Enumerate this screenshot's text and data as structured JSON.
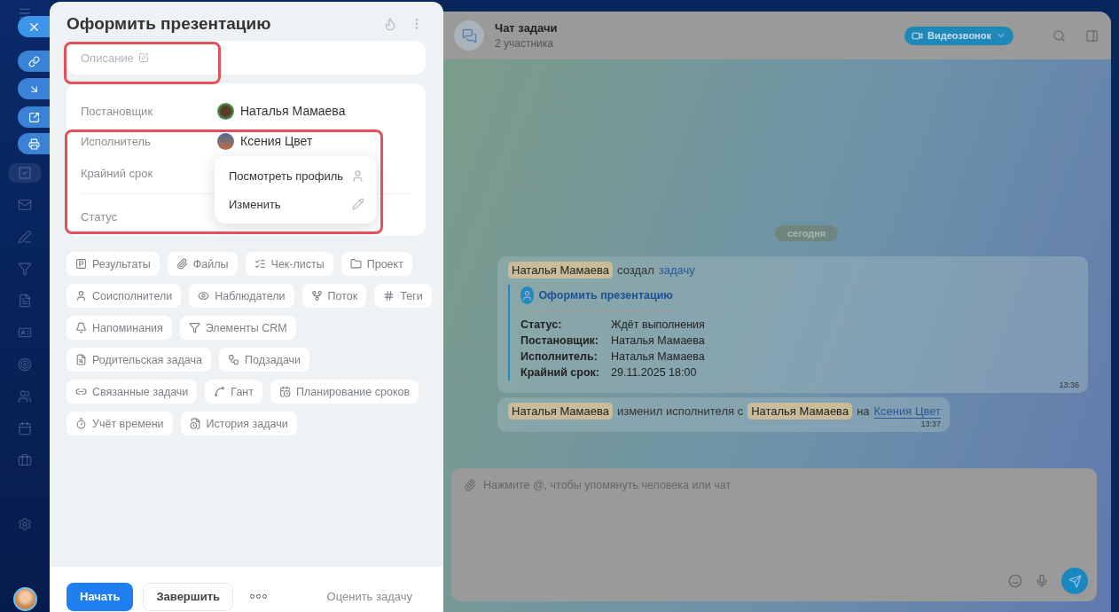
{
  "task": {
    "title": "Оформить презентацию",
    "description_placeholder": "Описание",
    "fields": [
      {
        "label": "Постановщик",
        "value": "Наталья Мамаева",
        "kind": "person"
      },
      {
        "label": "Исполнитель",
        "value": "Ксения Цвет",
        "kind": "person"
      },
      {
        "label": "Крайний срок",
        "kind": "empty"
      },
      {
        "label": "Статус",
        "kind": "empty"
      }
    ],
    "context_menu": [
      {
        "label": "Посмотреть профиль",
        "kind": "profile"
      },
      {
        "label": "Изменить",
        "kind": "edit"
      }
    ],
    "chip_rows": [
      [
        "Результаты",
        "Файлы",
        "Чек-листы",
        "Проект"
      ],
      [
        "Соисполнители",
        "Наблюдатели",
        "Поток",
        "Теги"
      ],
      [
        "Напоминания",
        "Элементы CRM"
      ],
      [
        "Родительская задача",
        "Подзадачи"
      ],
      [
        "Связанные задачи",
        "Гант",
        "Планирование сроков"
      ],
      [
        "Учёт времени",
        "История задачи"
      ]
    ],
    "footer": {
      "start": "Начать",
      "finish": "Завершить",
      "rate": "Оценить задачу"
    }
  },
  "chat": {
    "title": "Чат задачи",
    "subtitle": "2 участника",
    "video_button": "Видеозвонок",
    "date": "сегодня",
    "messages": [
      {
        "parts": [
          {
            "kind": "mention",
            "text": "Наталья Мамаева"
          },
          {
            "kind": "text",
            "text": "создал"
          },
          {
            "kind": "link",
            "text": "задачу"
          }
        ],
        "card": {
          "title": "Оформить презентацию",
          "rows": [
            {
              "label": "Статус:",
              "value": "Ждёт выполнения"
            },
            {
              "label": "Постановщик:",
              "value": "Наталья Мамаева"
            },
            {
              "label": "Исполнитель:",
              "value": "Наталья Мамаева"
            },
            {
              "label": "Крайний срок:",
              "value": "29.11.2025 18:00"
            }
          ]
        },
        "time": "13:36"
      },
      {
        "parts": [
          {
            "kind": "mention",
            "text": "Наталья Мамаева"
          },
          {
            "kind": "text",
            "text": "изменил исполнителя с"
          },
          {
            "kind": "mention",
            "text": "Наталья Мамаева"
          },
          {
            "kind": "text",
            "text": "на"
          },
          {
            "kind": "link",
            "text": "Ксения Цвет"
          }
        ],
        "time": "13:37"
      }
    ],
    "input_placeholder": "Нажмите @, чтобы упомянуть человека или чат"
  }
}
